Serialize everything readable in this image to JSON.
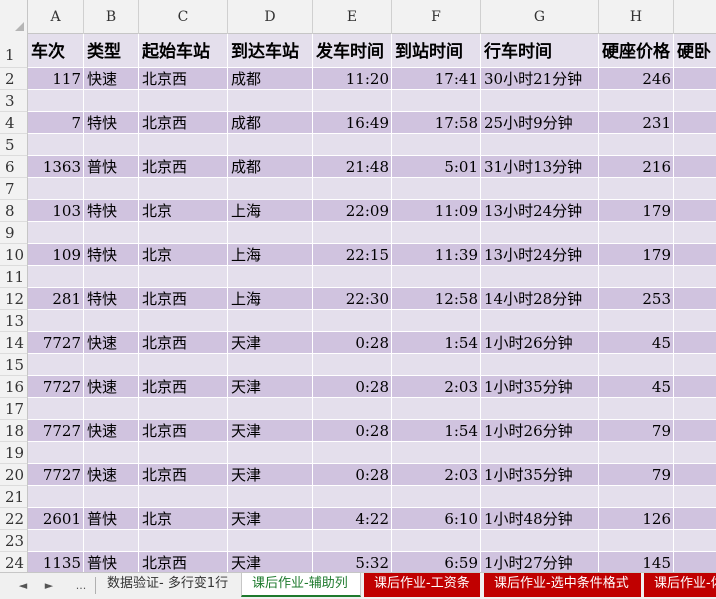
{
  "columns": [
    "A",
    "B",
    "C",
    "D",
    "E",
    "F",
    "G",
    "H",
    ""
  ],
  "row_numbers": [
    "1",
    "2",
    "3",
    "4",
    "5",
    "6",
    "7",
    "8",
    "9",
    "10",
    "11",
    "12",
    "13",
    "14",
    "15",
    "16",
    "17",
    "18",
    "19",
    "20",
    "21",
    "22",
    "23",
    "24"
  ],
  "header": [
    "车次",
    "类型",
    "起始车站",
    "到达车站",
    "发车时间",
    "到站时间",
    "行车时间",
    "硬座价格",
    "硬卧"
  ],
  "rows": [
    [
      "117",
      "快速",
      "北京西",
      "成都",
      "11:20",
      "17:41",
      "30小时21分钟",
      "246"
    ],
    [
      "7",
      "特快",
      "北京西",
      "成都",
      "16:49",
      "17:58",
      "25小时9分钟",
      "231"
    ],
    [
      "1363",
      "普快",
      "北京西",
      "成都",
      "21:48",
      "5:01",
      "31小时13分钟",
      "216"
    ],
    [
      "103",
      "特快",
      "北京",
      "上海",
      "22:09",
      "11:09",
      "13小时24分钟",
      "179"
    ],
    [
      "109",
      "特快",
      "北京",
      "上海",
      "22:15",
      "11:39",
      "13小时24分钟",
      "179"
    ],
    [
      "281",
      "特快",
      "北京西",
      "上海",
      "22:30",
      "12:58",
      "14小时28分钟",
      "253"
    ],
    [
      "7727",
      "快速",
      "北京西",
      "天津",
      "0:28",
      "1:54",
      "1小时26分钟",
      "45"
    ],
    [
      "7727",
      "快速",
      "北京西",
      "天津",
      "0:28",
      "2:03",
      "1小时35分钟",
      "45"
    ],
    [
      "7727",
      "快速",
      "北京西",
      "天津",
      "0:28",
      "1:54",
      "1小时26分钟",
      "79"
    ],
    [
      "7727",
      "快速",
      "北京西",
      "天津",
      "0:28",
      "2:03",
      "1小时35分钟",
      "79"
    ],
    [
      "2601",
      "普快",
      "北京",
      "天津",
      "4:22",
      "6:10",
      "1小时48分钟",
      "126"
    ],
    [
      "1135",
      "普快",
      "北京西",
      "天津",
      "5:32",
      "6:59",
      "1小时27分钟",
      "145"
    ]
  ],
  "tab_nav": [
    "◄",
    "►",
    "..."
  ],
  "tabs": [
    {
      "label": "数据验证- 多行变1行",
      "style": "plain"
    },
    {
      "label": "课后作业-辅助列",
      "style": "active"
    },
    {
      "label": "课后作业-工资条",
      "style": "red"
    },
    {
      "label": "课后作业-选中条件格式",
      "style": "red"
    },
    {
      "label": "课后作业-体",
      "style": "red"
    }
  ],
  "colors": {
    "band_data": "#d0c3df",
    "band_blank": "#e4dfec",
    "tab_red": "#c00000",
    "tab_active_text": "#1e7a2d"
  }
}
